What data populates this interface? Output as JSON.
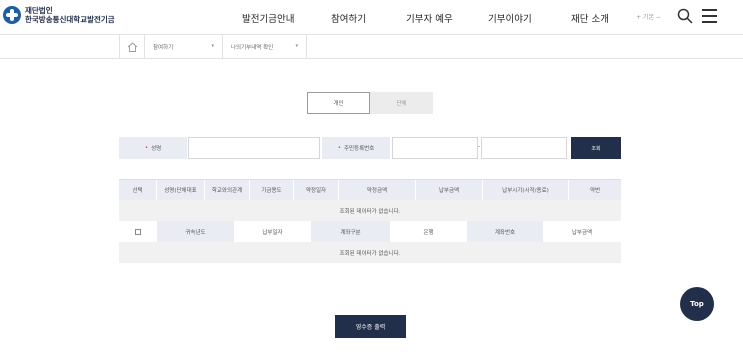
{
  "header": {
    "logo_line1": "재단법인",
    "logo_line2": "한국방송통신대학교발전기금",
    "nav": [
      "발전기금안내",
      "참여하기",
      "기부자 예우",
      "기부이야기",
      "재단 소개"
    ],
    "lang_label": "+ 기본 −"
  },
  "breadcrumb": {
    "items": [
      "참여하기",
      "나의기부내역 확인"
    ]
  },
  "tabs": [
    {
      "label": "개인",
      "active": true
    },
    {
      "label": "단체",
      "active": false
    }
  ],
  "search": {
    "name_label": "성명",
    "name_value": "",
    "id_label": "주민등록번호",
    "id_value_front": "",
    "id_separator": "-",
    "id_value_back": "",
    "submit_label": "조회"
  },
  "table": {
    "headers": [
      "선택",
      "성명(단체대표",
      "학교와의관계",
      "기금용도",
      "약정일자",
      "약정금액",
      "납부금액",
      "납부시기(시작/종료)",
      "약번"
    ],
    "empty_message": "조회된 데이터가 없습니다.",
    "sub_headers": [
      "귀속년도",
      "납부일자",
      "계좌구분",
      "은행",
      "계좌번호",
      "납부금액"
    ],
    "sub_empty_message": "조회된 데이터가 없습니다."
  },
  "actions": {
    "receipt_label": "영수증 출력",
    "top_label": "Top"
  }
}
